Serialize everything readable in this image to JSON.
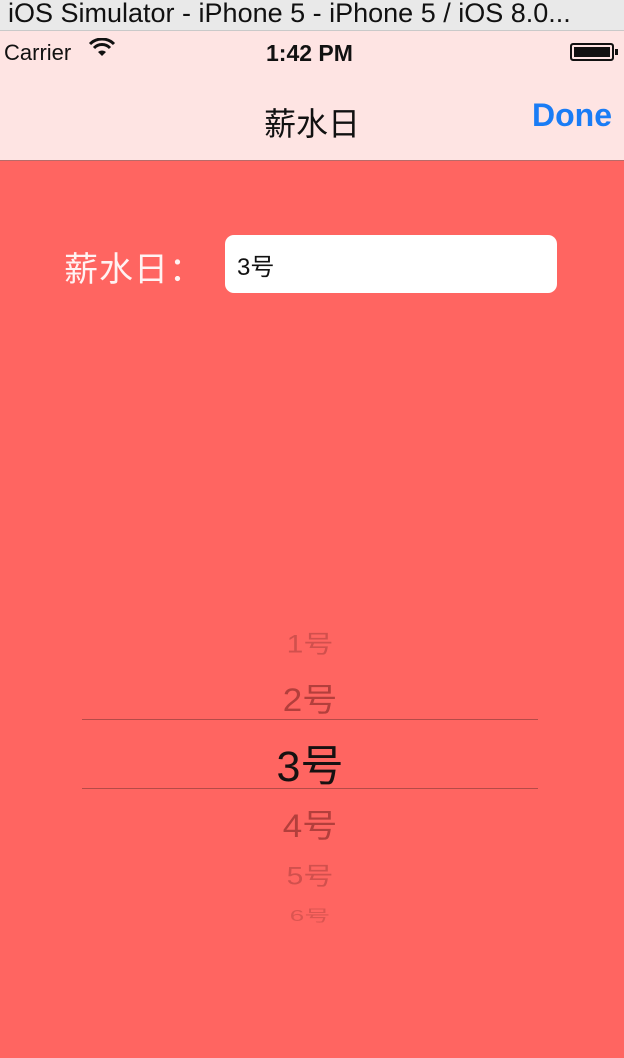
{
  "window": {
    "title": "iOS Simulator - iPhone 5 - iPhone 5 / iOS 8.0..."
  },
  "status_bar": {
    "carrier": "Carrier",
    "time": "1:42 PM",
    "wifi_icon": "wifi-icon",
    "battery_icon": "battery-icon"
  },
  "nav_bar": {
    "title": "薪水日",
    "done_label": "Done"
  },
  "form": {
    "label": "薪水日：",
    "value": "3号"
  },
  "picker": {
    "items": [
      "1号",
      "2号",
      "3号",
      "4号",
      "5号",
      "6号"
    ],
    "selected": "3号"
  },
  "colors": {
    "background": "#ff6561",
    "nav_background": "#fee4e3",
    "accent": "#1a7cf5"
  }
}
